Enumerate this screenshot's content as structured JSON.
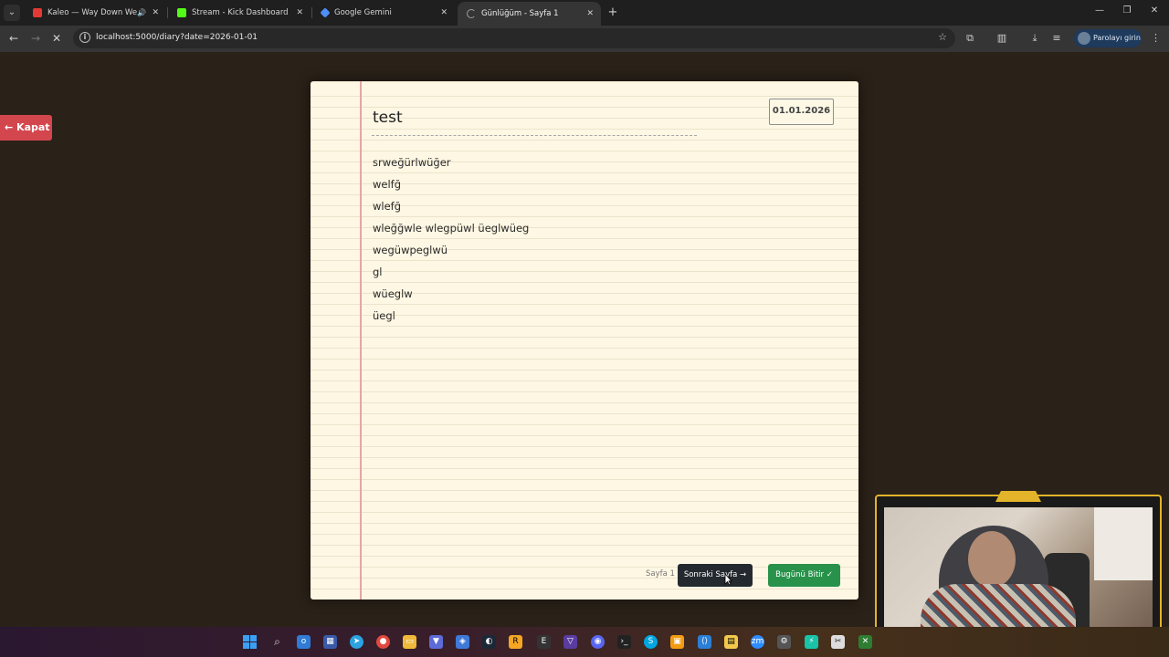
{
  "browser": {
    "tabs": [
      {
        "title": "Kaleo — Way Down We Go",
        "favicon_color": "#e53935",
        "active": false,
        "audio": true
      },
      {
        "title": "Stream - Kick Dashboard",
        "favicon_color": "#53fc18",
        "active": false,
        "audio": false
      },
      {
        "title": "Google Gemini",
        "favicon_color": "#4f8df7",
        "active": false,
        "audio": false
      },
      {
        "title": "Günlüğüm - Sayfa 1",
        "favicon_color": "#9aa0a6",
        "active": true,
        "audio": false
      }
    ],
    "url": "localhost:5000/diary?date=2026-01-01",
    "profile_label": "Parolayı girin"
  },
  "app": {
    "close_button": "← Kapat",
    "diary": {
      "title": "test",
      "date": "01.01.2026",
      "lines": [
        "srweğürlwüğer",
        "welfğ",
        "wlefğ",
        "wleğğwle wlegpüwl üeglwüeg",
        "wegüwpeglwü",
        "gl",
        "wüeglw",
        "üegl"
      ]
    },
    "footer": {
      "page_indicator": "Sayfa 1",
      "next_button": "Sonraki Sayfa →",
      "finish_button": "Bugünü Bitir ✓"
    }
  },
  "colors": {
    "close_button": "#d4464d",
    "next_button": "#24292f",
    "finish_button": "#28924a",
    "paper": "#fdf7e4",
    "margin_line": "#e4a5a5",
    "webcam_border": "#e3b32a"
  }
}
